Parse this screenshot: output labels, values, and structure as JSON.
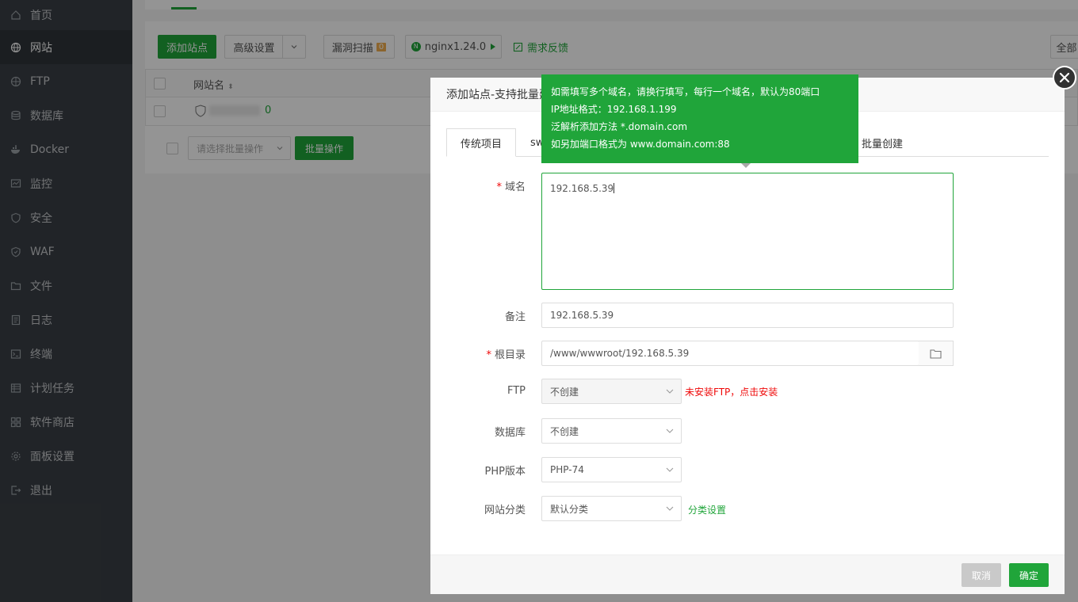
{
  "sidebar": {
    "items": [
      {
        "label": "首页"
      },
      {
        "label": "网站"
      },
      {
        "label": "FTP"
      },
      {
        "label": "数据库"
      },
      {
        "label": "Docker"
      },
      {
        "label": "监控"
      },
      {
        "label": "安全"
      },
      {
        "label": "WAF"
      },
      {
        "label": "文件"
      },
      {
        "label": "日志"
      },
      {
        "label": "终端"
      },
      {
        "label": "计划任务"
      },
      {
        "label": "软件商店"
      },
      {
        "label": "面板设置"
      },
      {
        "label": "退出"
      }
    ]
  },
  "toolbar": {
    "add_site": "添加站点",
    "advanced": "高级设置",
    "vuln_scan": "漏洞扫描",
    "vuln_count": "0",
    "nginx": "nginx1.24.0",
    "feedback": "需求反馈",
    "all": "全部"
  },
  "table": {
    "col_site_name": "网站名",
    "row_site_suffix": "0",
    "batch_placeholder": "请选择批量操作",
    "batch_button": "批量操作"
  },
  "modal": {
    "title": "添加站点-支持批量建",
    "tabs": [
      "传统项目",
      "sw",
      "批量创建"
    ],
    "domain_label": "域名",
    "domain_value": "192.168.5.39",
    "remark_label": "备注",
    "remark_value": "192.168.5.39",
    "root_label": "根目录",
    "root_value": "/www/wwwroot/192.168.5.39",
    "ftp_label": "FTP",
    "ftp_value": "不创建",
    "ftp_hint": "未安装FTP，点击安装",
    "db_label": "数据库",
    "db_value": "不创建",
    "php_label": "PHP版本",
    "php_value": "PHP-74",
    "category_label": "网站分类",
    "category_value": "默认分类",
    "category_link": "分类设置",
    "cancel": "取消",
    "confirm": "确定"
  },
  "tooltip": {
    "lines": [
      "如需填写多个域名，请换行填写，每行一个域名，默认为80端口",
      "IP地址格式：192.168.1.199",
      "泛解析添加方法 *.domain.com",
      "如另加端口格式为 www.domain.com:88"
    ]
  },
  "colors": {
    "accent": "#20a53a",
    "sidebar_bg": "#3a3f45",
    "error": "#ef0808"
  }
}
